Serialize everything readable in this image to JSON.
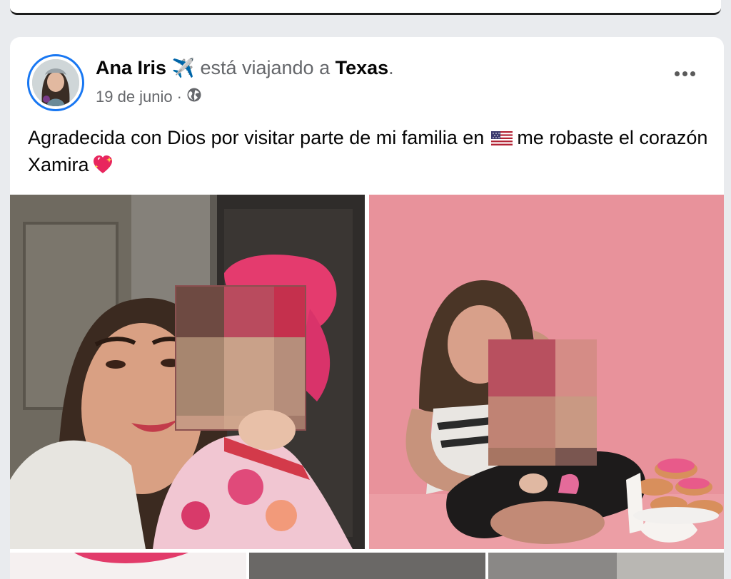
{
  "post": {
    "author_name": "Ana Iris",
    "plane_emoji": "✈️",
    "activity": "está viajando a",
    "place": "Texas",
    "place_suffix": ".",
    "date": "19 de junio",
    "separator": "·",
    "privacy_icon": "globe-icon",
    "text_part1": "Agradecida con Dios por visitar parte de mi familia en",
    "flag_emoji": "us-flag",
    "text_part2": "me robaste el corazón Xamira",
    "heart_emoji": "sparkling-heart"
  },
  "photos": [
    {
      "label": "photo-1"
    },
    {
      "label": "photo-2"
    }
  ],
  "colors": {
    "accent": "#1877f2",
    "secondary_text": "#65676b",
    "primary_text": "#050505",
    "pink_backdrop": "#e8929b"
  }
}
